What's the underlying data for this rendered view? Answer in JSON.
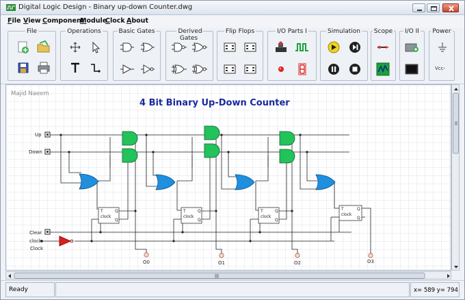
{
  "window": {
    "title": "Digital Logic Design - Binary up-down Counter.dwg"
  },
  "menu": [
    {
      "label": "File",
      "accel": "F",
      "rest": "ile"
    },
    {
      "label": "View",
      "accel": "V",
      "rest": "iew"
    },
    {
      "label": "Component",
      "accel": "C",
      "rest": "omponent"
    },
    {
      "label": "Module",
      "accel": "M",
      "rest": "odule"
    },
    {
      "label": "Clock",
      "accel": "C",
      "rest": "lock"
    },
    {
      "label": "About",
      "accel": "A",
      "rest": "bout"
    }
  ],
  "toolbar": {
    "groups": [
      "File",
      "Operations",
      "Basic Gates",
      "Derived Gates",
      "Flip Flops",
      "I/O Parts I",
      "Simulation",
      "Scope",
      "I/O II",
      "Power"
    ],
    "power_vcc": "Vcc-"
  },
  "canvas": {
    "author": "Majid Naeem",
    "title": "4 Bit Binary Up-Down Counter",
    "inputs": {
      "up": "Up",
      "down": "Down",
      "clear": "Clear",
      "clock_small": "clock",
      "clock": "Clock"
    },
    "ff_labels": {
      "t": "T",
      "q": "Q",
      "qbar": "Q",
      "clock": "clock"
    },
    "outputs": [
      "O0",
      "O1",
      "O2",
      "O3"
    ]
  },
  "status": {
    "ready": "Ready",
    "coords": "x= 589  y= 794"
  },
  "colors": {
    "and_gate": "#22c35a",
    "or_gate": "#1f8fe0",
    "clock_buffer": "#e01e1e",
    "title": "#1a2aa0"
  }
}
